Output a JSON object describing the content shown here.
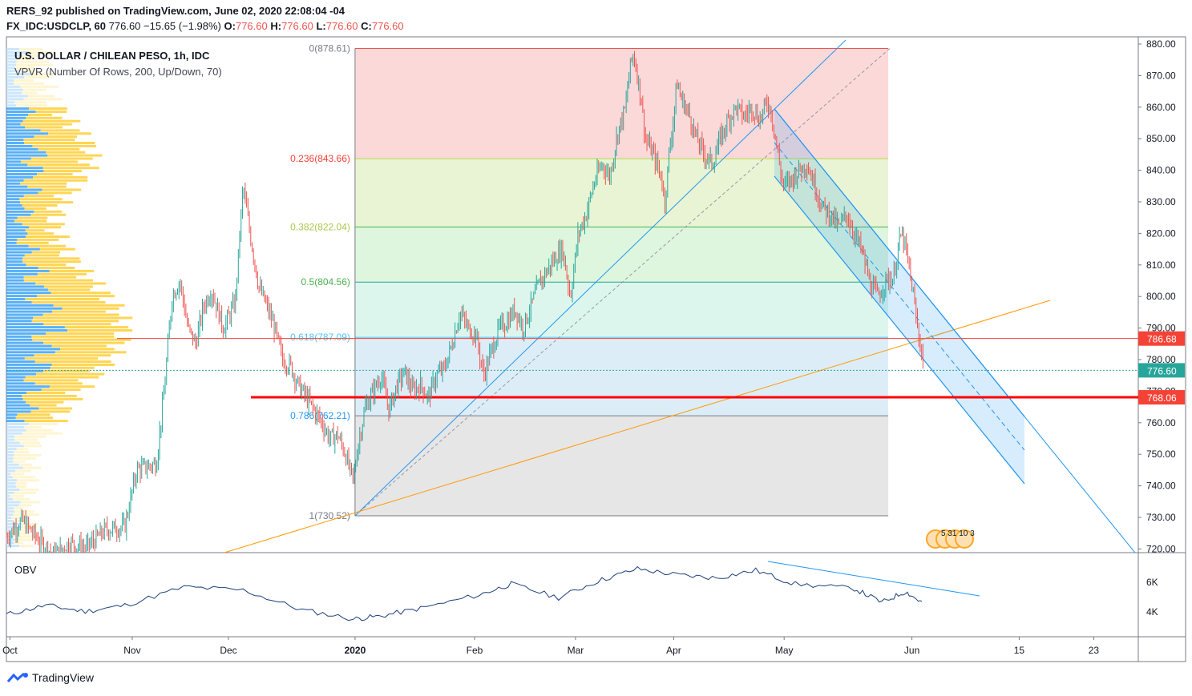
{
  "header": {
    "line1": "RERS_92 published on TradingView.com, June 02, 2020 22:08:04 -04",
    "line2_symbol": "FX_IDC:USDCLP, 60",
    "line2_last": "776.60",
    "line2_change": "−15.65 (−1.98%)",
    "line2_o_label": "O:",
    "line2_o": "776.60",
    "line2_h_label": "H:",
    "line2_h": "776.60",
    "line2_l_label": "L:",
    "line2_l": "776.60",
    "line2_c_label": "C:",
    "line2_c": "776.60"
  },
  "footer": {
    "brand": "TradingView"
  },
  "chart_data": {
    "type": "candlestick",
    "title": "U.S. DOLLAR / CHILEAN PESO, 1h, IDC",
    "indicator_label": "VPVR (Number Of Rows, 200, Up/Down, 70)",
    "y_ticks": [
      "880.00",
      "870.00",
      "860.00",
      "850.00",
      "840.00",
      "830.00",
      "820.00",
      "810.00",
      "800.00",
      "790.00",
      "780.00",
      "770.00",
      "760.00",
      "750.00",
      "740.00",
      "730.00",
      "720.00"
    ],
    "ylim": [
      718,
      881
    ],
    "x_ticks": [
      {
        "label": "Oct",
        "t": 0.9
      },
      {
        "label": "Nov",
        "t": 31.9
      },
      {
        "label": "Dec",
        "t": 56.3
      },
      {
        "label": "2020",
        "t": 88.4,
        "bold": true
      },
      {
        "label": "Feb",
        "t": 118.7
      },
      {
        "label": "Mar",
        "t": 144.3
      },
      {
        "label": "Apr",
        "t": 169.2
      },
      {
        "label": "May",
        "t": 197.2
      },
      {
        "label": "Jun",
        "t": 229.6
      },
      {
        "label": "15",
        "t": 256.8
      },
      {
        "label": "23",
        "t": 275.7
      }
    ],
    "price_path": [
      [
        0,
        724
      ],
      [
        4,
        729
      ],
      [
        8,
        723
      ],
      [
        12,
        718
      ],
      [
        16,
        722
      ],
      [
        20,
        720
      ],
      [
        25,
        726
      ],
      [
        30,
        727
      ],
      [
        33,
        745
      ],
      [
        38,
        747
      ],
      [
        40,
        770
      ],
      [
        42,
        800
      ],
      [
        44,
        805
      ],
      [
        46,
        790
      ],
      [
        48,
        785
      ],
      [
        50,
        797
      ],
      [
        52,
        802
      ],
      [
        55,
        790
      ],
      [
        58,
        798
      ],
      [
        60,
        835
      ],
      [
        62,
        818
      ],
      [
        64,
        803
      ],
      [
        66,
        797
      ],
      [
        68,
        790
      ],
      [
        70,
        780
      ],
      [
        72,
        778
      ],
      [
        74,
        772
      ],
      [
        76,
        768
      ],
      [
        78,
        764
      ],
      [
        80,
        760
      ],
      [
        82,
        755
      ],
      [
        84,
        756
      ],
      [
        86,
        750
      ],
      [
        87,
        745
      ],
      [
        88,
        742
      ],
      [
        89,
        752
      ],
      [
        91,
        765
      ],
      [
        93,
        770
      ],
      [
        95,
        775
      ],
      [
        97,
        764
      ],
      [
        99,
        772
      ],
      [
        101,
        776
      ],
      [
        103,
        770
      ],
      [
        105,
        772
      ],
      [
        107,
        768
      ],
      [
        109,
        775
      ],
      [
        111,
        777
      ],
      [
        113,
        785
      ],
      [
        115,
        795
      ],
      [
        117,
        790
      ],
      [
        119,
        788
      ],
      [
        121,
        775
      ],
      [
        123,
        783
      ],
      [
        125,
        790
      ],
      [
        127,
        792
      ],
      [
        129,
        796
      ],
      [
        131,
        790
      ],
      [
        133,
        797
      ],
      [
        135,
        804
      ],
      [
        137,
        808
      ],
      [
        139,
        812
      ],
      [
        141,
        815
      ],
      [
        143,
        800
      ],
      [
        145,
        820
      ],
      [
        147,
        826
      ],
      [
        149,
        836
      ],
      [
        151,
        842
      ],
      [
        153,
        838
      ],
      [
        155,
        852
      ],
      [
        157,
        860
      ],
      [
        158,
        872
      ],
      [
        159,
        877
      ],
      [
        160,
        870
      ],
      [
        161,
        862
      ],
      [
        162,
        850
      ],
      [
        164,
        845
      ],
      [
        166,
        838
      ],
      [
        167,
        830
      ],
      [
        168,
        845
      ],
      [
        169,
        855
      ],
      [
        170,
        868
      ],
      [
        171,
        863
      ],
      [
        173,
        858
      ],
      [
        175,
        850
      ],
      [
        177,
        845
      ],
      [
        179,
        842
      ],
      [
        181,
        850
      ],
      [
        183,
        856
      ],
      [
        185,
        860
      ],
      [
        187,
        857
      ],
      [
        189,
        860
      ],
      [
        191,
        856
      ],
      [
        193,
        862
      ],
      [
        194,
        858
      ],
      [
        195,
        850
      ],
      [
        196,
        842
      ],
      [
        197,
        835
      ],
      [
        199,
        837
      ],
      [
        201,
        840
      ],
      [
        203,
        842
      ],
      [
        205,
        835
      ],
      [
        207,
        828
      ],
      [
        209,
        826
      ],
      [
        211,
        822
      ],
      [
        213,
        826
      ],
      [
        215,
        820
      ],
      [
        217,
        814
      ],
      [
        219,
        804
      ],
      [
        221,
        800
      ],
      [
        223,
        805
      ],
      [
        225,
        806
      ],
      [
        226,
        815
      ],
      [
        227,
        820
      ],
      [
        228,
        815
      ],
      [
        229,
        808
      ],
      [
        230,
        800
      ],
      [
        231,
        790
      ],
      [
        232,
        783
      ],
      [
        232.6,
        776.6
      ]
    ],
    "last_price": 776.6,
    "fibonacci": {
      "levels": [
        {
          "label": "0(878.61)",
          "value": 878.61,
          "color": "#ef5350",
          "fill": "rgba(239,83,80,0.22)"
        },
        {
          "label": "0.236(843.66)",
          "value": 843.66,
          "color": "#b5d945",
          "fill": "rgba(205,230,160,0.45)"
        },
        {
          "label": "0.382(822.04)",
          "value": 822.04,
          "color": "#4caf50",
          "fill": "rgba(180,235,180,0.45)"
        },
        {
          "label": "0.5(804.56)",
          "value": 804.56,
          "color": "#26a69a",
          "fill": "rgba(180,235,215,0.45)"
        },
        {
          "label": "0.618(787.09)",
          "value": 787.09,
          "color": "#4fc3f7",
          "fill": "rgba(180,215,240,0.45)"
        },
        {
          "label": "0.786(762.21)",
          "value": 762.21,
          "color": "#787b86",
          "fill": "rgba(210,210,212,0.55)"
        },
        {
          "label": "1(730.52)",
          "value": 730.52,
          "color": "#787b86",
          "fill": ""
        }
      ],
      "label_colors": [
        "#787b86",
        "#f44336",
        "#a8c94a",
        "#4caf50",
        "#4fc3f7",
        "#2196f3",
        "#787b86"
      ],
      "start_t": 88.4,
      "end_t": 223.6
    },
    "horizontal_lines": [
      {
        "value": 786.68,
        "label": "786.68",
        "color": "#f44336",
        "width": 1
      },
      {
        "value": 768.06,
        "label": "768.06",
        "color": "#ff0000",
        "width": 3
      },
      {
        "value": 776.6,
        "label": "776.60",
        "color": "#26a69a",
        "width": 1,
        "dotted": true
      }
    ],
    "obv": {
      "label": "OBV",
      "y_ticks": [
        "6K",
        "4K"
      ],
      "path": [
        [
          0,
          4.2
        ],
        [
          10,
          4.8
        ],
        [
          20,
          4.4
        ],
        [
          30,
          4.8
        ],
        [
          45,
          6.0
        ],
        [
          60,
          5.8
        ],
        [
          75,
          4.5
        ],
        [
          88,
          3.9
        ],
        [
          95,
          4.1
        ],
        [
          105,
          4.6
        ],
        [
          120,
          5.5
        ],
        [
          128,
          6.2
        ],
        [
          140,
          5.3
        ],
        [
          150,
          6.4
        ],
        [
          160,
          7.2
        ],
        [
          170,
          6.8
        ],
        [
          180,
          6.6
        ],
        [
          190,
          7.1
        ],
        [
          200,
          6.2
        ],
        [
          215,
          5.9
        ],
        [
          222,
          5.0
        ],
        [
          228,
          5.7
        ],
        [
          232.6,
          4.9
        ]
      ]
    }
  }
}
